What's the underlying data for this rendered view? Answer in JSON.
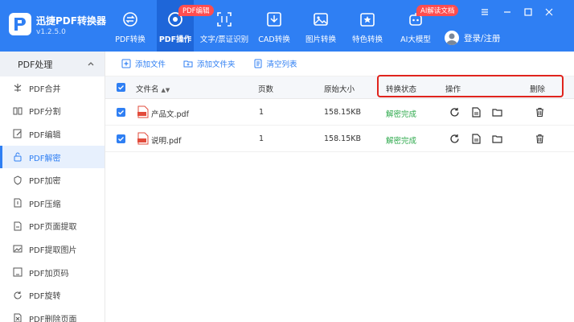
{
  "app": {
    "title": "迅捷PDF转换器",
    "version": "v1.2.5.0"
  },
  "nav": [
    {
      "label": "PDF转换",
      "icon": "swap-circle-icon"
    },
    {
      "label": "PDF操作",
      "icon": "pdf-tools-icon",
      "badge": "PDF编辑",
      "active": true
    },
    {
      "label": "文字/票证识别",
      "icon": "ocr-scan-icon"
    },
    {
      "label": "CAD转换",
      "icon": "cad-download-icon"
    },
    {
      "label": "图片转换",
      "icon": "image-icon"
    },
    {
      "label": "特色转换",
      "icon": "star-box-icon"
    },
    {
      "label": "AI大模型",
      "icon": "ai-robot-icon",
      "badge": "AI解读文档"
    }
  ],
  "login": {
    "label": "登录/注册"
  },
  "sidebar": {
    "header": "PDF处理",
    "items": [
      {
        "label": "PDF合并",
        "icon": "merge-icon"
      },
      {
        "label": "PDF分割",
        "icon": "split-icon"
      },
      {
        "label": "PDF编辑",
        "icon": "edit-icon"
      },
      {
        "label": "PDF解密",
        "icon": "unlock-icon",
        "active": true
      },
      {
        "label": "PDF加密",
        "icon": "shield-icon"
      },
      {
        "label": "PDF压缩",
        "icon": "compress-icon"
      },
      {
        "label": "PDF页面提取",
        "icon": "page-extract-icon"
      },
      {
        "label": "PDF提取图片",
        "icon": "image-extract-icon"
      },
      {
        "label": "PDF加页码",
        "icon": "page-number-icon"
      },
      {
        "label": "PDF旋转",
        "icon": "rotate-icon"
      },
      {
        "label": "PDF删除页面",
        "icon": "delete-page-icon"
      }
    ]
  },
  "toolbar": {
    "add_file": "添加文件",
    "add_folder": "添加文件夹",
    "clear_list": "清空列表"
  },
  "table": {
    "headers": {
      "filename": "文件名",
      "pages": "页数",
      "size": "原始大小",
      "status": "转换状态",
      "actions": "操作",
      "delete": "删除"
    },
    "rows": [
      {
        "filename": "产品文.pdf",
        "pages": "1",
        "size": "158.15KB",
        "status": "解密完成"
      },
      {
        "filename": "说明.pdf",
        "pages": "1",
        "size": "158.15KB",
        "status": "解密完成"
      }
    ]
  },
  "colors": {
    "primary": "#2f7ff3",
    "success": "#2ba84a",
    "badge": "#ff4d4f",
    "highlight": "#e0241d"
  }
}
